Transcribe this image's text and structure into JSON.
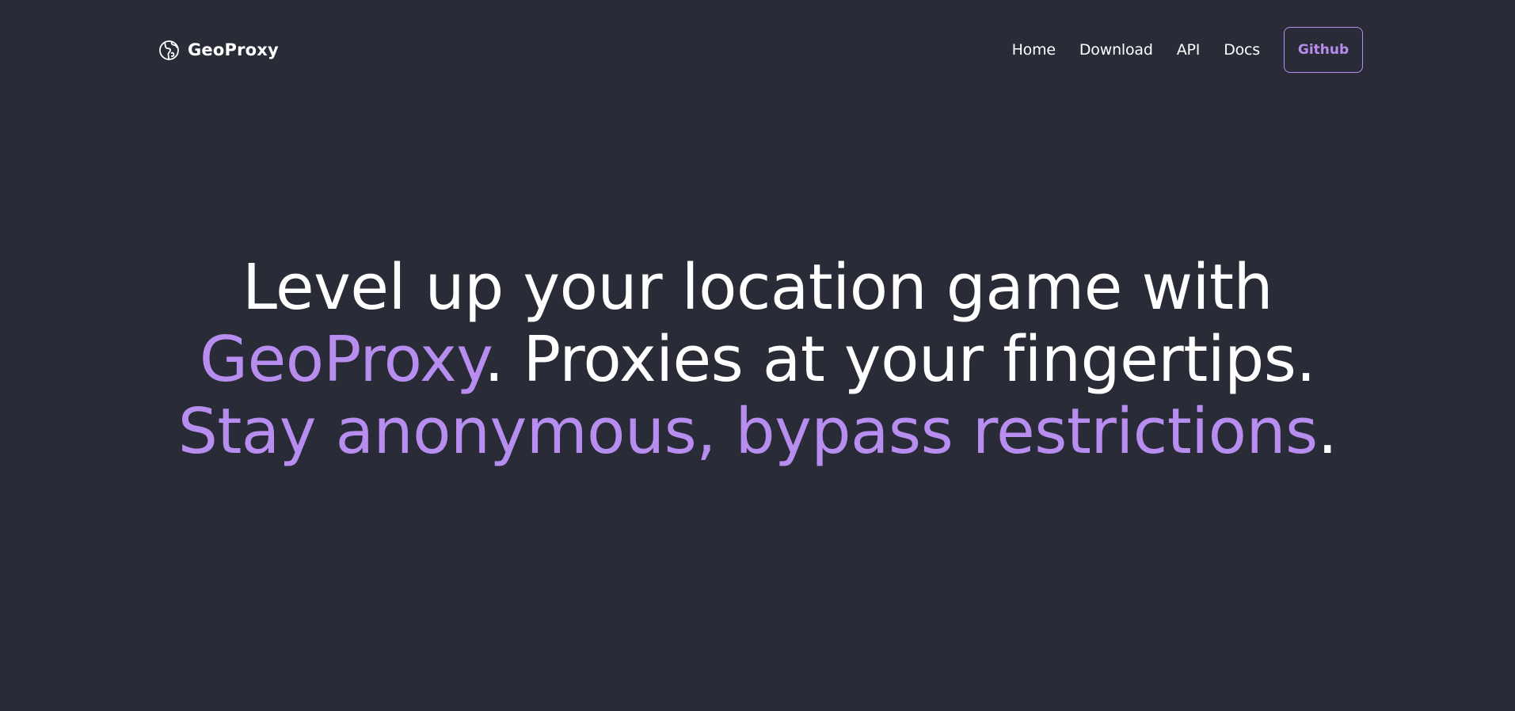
{
  "colors": {
    "background": "#292b37",
    "accent": "#b88df0",
    "text": "#ffffff"
  },
  "navbar": {
    "brand": {
      "icon": "globe-icon",
      "name": "GeoProxy"
    },
    "links": [
      {
        "label": "Home"
      },
      {
        "label": "Download"
      },
      {
        "label": "API"
      },
      {
        "label": "Docs"
      }
    ],
    "github_label": "Github"
  },
  "hero": {
    "segments": [
      {
        "text": "Level up your location game with ",
        "accent": false
      },
      {
        "text": "GeoProxy",
        "accent": true
      },
      {
        "text": ". Proxies at your fingertips. ",
        "accent": false
      },
      {
        "text": "Stay anonymous, bypass restrictions",
        "accent": true
      },
      {
        "text": ".",
        "accent": false
      }
    ]
  }
}
